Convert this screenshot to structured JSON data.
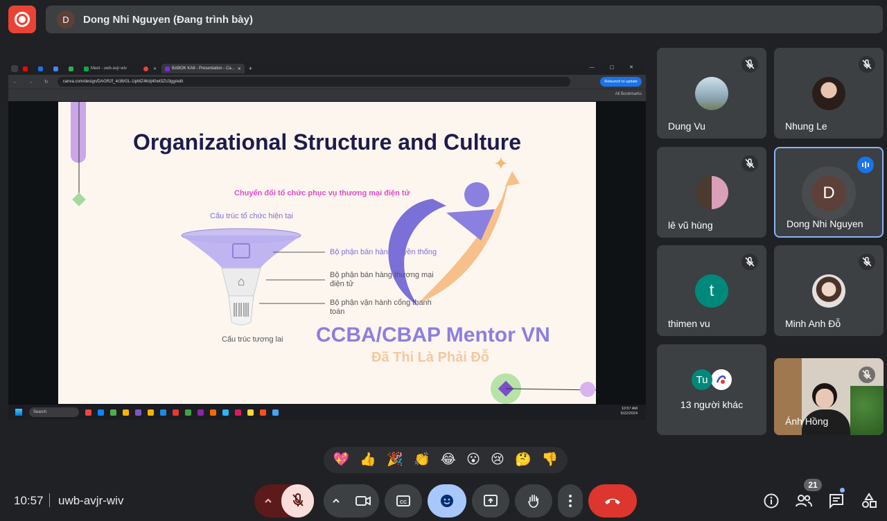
{
  "presenter_bar": {
    "avatar_letter": "D",
    "text": "Dong Nhi Nguyen (Đang trình bày)"
  },
  "shared_screen": {
    "browser": {
      "tabs": [
        {
          "label": "",
          "icon_color": "#ff0000"
        },
        {
          "label": "",
          "icon_color": "#1a73e8"
        },
        {
          "label": "",
          "icon_color": "#4285f4"
        },
        {
          "label": "",
          "icon_color": "#34a853"
        },
        {
          "label": "Meet - uwb-avjr-wiv",
          "icon_color": "#00ac47"
        },
        {
          "label": "",
          "icon_color": "#ea4335"
        },
        {
          "label": "BABOK KA6 - Presentation - Ca...",
          "icon_color": "#7d2ae8"
        }
      ],
      "url": "canva.com/design/DAGR2f_4r38/GL-1ipMZ4Kdj40wt3ZU3gg/edit",
      "relaunch_label": "Relaunch to update",
      "bookmarks_label": "All Bookmarks"
    },
    "slide": {
      "title": "Organizational Structure and Culture",
      "subtitle_pink": "Chuyển đổi tổ chức phục vụ thương mại điện tử",
      "current_structure": "Cấu trúc tổ chức hiện tại",
      "future_structure": "Cấu trúc tương lai",
      "items": [
        "Bộ phận bán hàng truyền thống",
        "Bộ phận bán hàng thương mại điện tử",
        "Bộ phận vận hành cổng thanh toán"
      ],
      "brand_line1": "CCBA/CBAP Mentor VN",
      "brand_line2": "Đã Thi Là Phải Đỗ"
    },
    "taskbar": {
      "search_label": "Search",
      "time": "10:57 AM",
      "date": "9/22/2024"
    }
  },
  "participants": [
    {
      "name": "Dung Vu",
      "muted": true,
      "avatar": "photo",
      "avatar_color": "#8fa8b8"
    },
    {
      "name": "Nhung Le",
      "muted": true,
      "avatar": "photo",
      "avatar_color": "#c9a898"
    },
    {
      "name": "lê vũ hùng",
      "muted": true,
      "avatar": "photo",
      "avatar_color": "#9b8b7a"
    },
    {
      "name": "Dong Nhi Nguyen",
      "muted": false,
      "speaking": true,
      "avatar": "D",
      "avatar_color": "#5d4037"
    },
    {
      "name": "thimen vu",
      "muted": true,
      "avatar": "t",
      "avatar_color": "#00897b"
    },
    {
      "name": "Minh Anh Đỗ",
      "muted": true,
      "avatar": "photo",
      "avatar_color": "#d8c4b8"
    },
    {
      "name": "Ánh Hồng",
      "muted": true,
      "avatar": "video",
      "avatar_color": "#e8ddd0"
    }
  ],
  "others_tile": {
    "avatar_letter": "Tu",
    "avatar_color": "#00897b",
    "label": "13 người khác"
  },
  "reactions": [
    "💖",
    "👍",
    "🎉",
    "👏",
    "😂",
    "😮",
    "😢",
    "🤔",
    "👎"
  ],
  "bottom_bar": {
    "time": "10:57",
    "meeting_code": "uwb-avjr-wiv",
    "people_count": "21",
    "icons": [
      "chevron-up-icon",
      "mic-off-icon",
      "camera-icon",
      "captions-icon",
      "emoji-icon",
      "present-icon",
      "raise-hand-icon",
      "more-icon",
      "end-call-icon",
      "info-icon",
      "people-icon",
      "chat-icon",
      "activities-icon"
    ]
  },
  "colors": {
    "background": "#202124",
    "tile": "#3c4043",
    "record": "#ea4335",
    "end_call": "#ea4335",
    "active_blue": "#8ab4f8"
  }
}
